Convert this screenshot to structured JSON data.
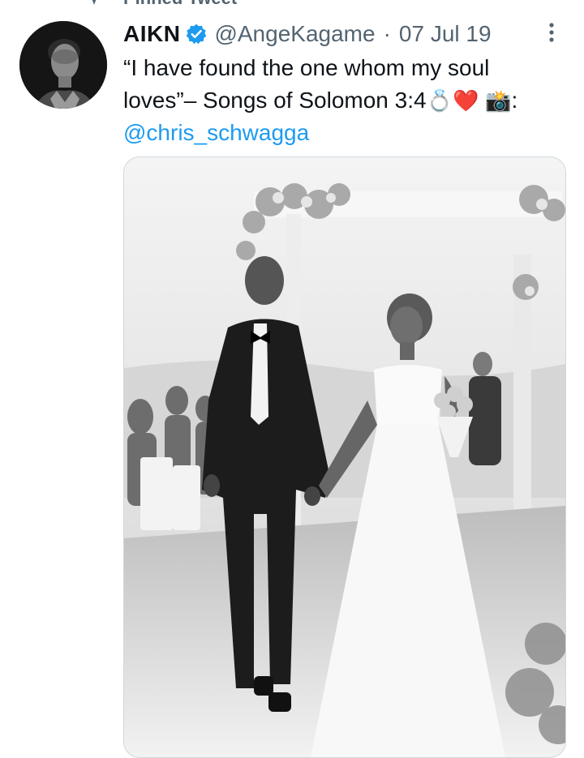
{
  "pinned": {
    "label": "Pinned Tweet"
  },
  "tweet": {
    "display_name": "AIKN",
    "handle": "@AngeKagame",
    "separator": "·",
    "date": "07 Jul 19",
    "text_line1": "“I have found the one whom my soul",
    "text_line2_prefix": "loves”– Songs of Solomon 3:4",
    "emoji_ring": "💍",
    "emoji_heart": "❤️",
    "emoji_camera": "📸",
    "text_line2_suffix": ":",
    "mention": "@chris_schwagga"
  },
  "colors": {
    "link": "#1d9bf0",
    "verified": "#1d9bf0",
    "secondary_text": "#536471"
  },
  "icons": [
    "pin-icon",
    "verified-badge-icon",
    "more-options-icon"
  ]
}
